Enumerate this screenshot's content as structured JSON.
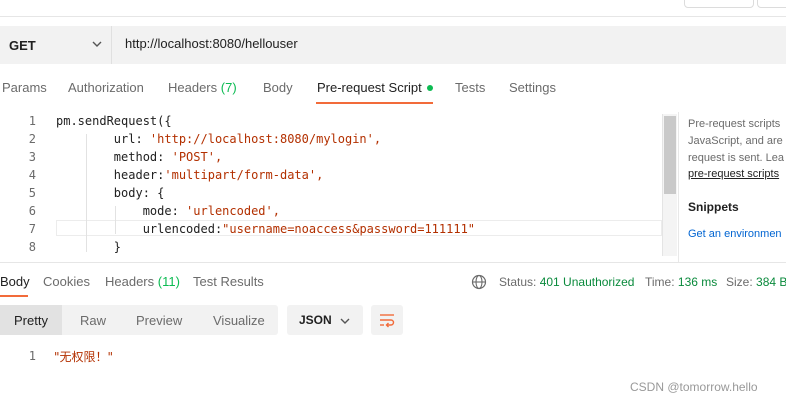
{
  "request": {
    "method": "GET",
    "url": "http://localhost:8080/hellouser"
  },
  "tabs": [
    {
      "label": "Params"
    },
    {
      "label": "Authorization"
    },
    {
      "label": "Headers",
      "count": "(7)"
    },
    {
      "label": "Body"
    },
    {
      "label": "Pre-request Script",
      "active": true
    },
    {
      "label": "Tests"
    },
    {
      "label": "Settings"
    }
  ],
  "script": {
    "line_numbers": [
      "1",
      "2",
      "3",
      "4",
      "5",
      "6",
      "7",
      "8"
    ],
    "lines": [
      {
        "plain": "pm.sendRequest({",
        "str": ""
      },
      {
        "plain": "        url: ",
        "str": "'http://localhost:8080/mylogin',"
      },
      {
        "plain": "        method: ",
        "str": "'POST',"
      },
      {
        "plain": "        header:",
        "str": "'multipart/form-data',"
      },
      {
        "plain": "        body: {",
        "str": ""
      },
      {
        "plain": "            mode: ",
        "str": "'urlencoded',"
      },
      {
        "plain": "            urlencoded:",
        "str": "\"username=noaccess&password=111111\""
      },
      {
        "plain": "        }",
        "str": ""
      }
    ]
  },
  "side_panel": {
    "description_lines": [
      "Pre-request scripts",
      "JavaScript, and are",
      "request is sent. Lea"
    ],
    "link": "pre-request scripts",
    "snippets_title": "Snippets",
    "snippet_first": "Get an environmen"
  },
  "response": {
    "tabs": [
      {
        "label": "Body",
        "active": true
      },
      {
        "label": "Cookies"
      },
      {
        "label": "Headers",
        "count": "(11)"
      },
      {
        "label": "Test Results"
      }
    ],
    "status_label": "Status:",
    "status_value": "401 Unauthorized",
    "time_label": "Time:",
    "time_value": "136 ms",
    "size_label": "Size:",
    "size_value": "384 B",
    "view_modes": [
      "Pretty",
      "Raw",
      "Preview",
      "Visualize"
    ],
    "format": "JSON",
    "body_line_number": "1",
    "body_text": "\"无权限！\""
  },
  "watermark": "CSDN @tomorrow.hello",
  "colors": {
    "accent": "#f26b3a",
    "success": "#0cbb52",
    "string": "#b33000",
    "link": "#0265d2"
  }
}
